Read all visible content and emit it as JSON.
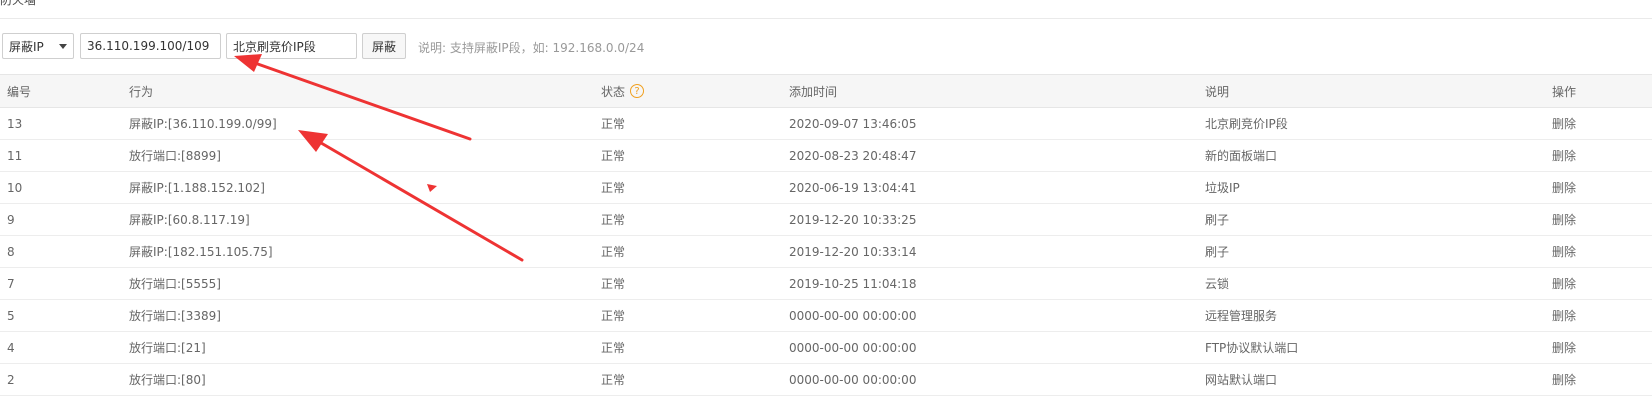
{
  "header": {
    "title_clipped": "防火墙"
  },
  "controls": {
    "type_select": "屏蔽IP",
    "ip_value": "36.110.199.100/109",
    "note_value": "北京刷竞价IP段",
    "submit_label": "屏蔽",
    "hint": "说明: 支持屏蔽IP段，如: 192.168.0.0/24"
  },
  "table": {
    "headers": {
      "id": "编号",
      "action": "行为",
      "status": "状态",
      "time": "添加时间",
      "note": "说明",
      "op": "操作"
    },
    "status_help": "?",
    "rows": [
      {
        "id": "13",
        "action": "屏蔽IP:[36.110.199.0/99]",
        "status": "正常",
        "time": "2020-09-07 13:46:05",
        "note": "北京刷竞价IP段",
        "op": "删除"
      },
      {
        "id": "11",
        "action": "放行端口:[8899]",
        "status": "正常",
        "time": "2020-08-23 20:48:47",
        "note": "新的面板端口",
        "op": "删除"
      },
      {
        "id": "10",
        "action": "屏蔽IP:[1.188.152.102]",
        "status": "正常",
        "time": "2020-06-19 13:04:41",
        "note": "垃圾IP",
        "op": "删除"
      },
      {
        "id": "9",
        "action": "屏蔽IP:[60.8.117.19]",
        "status": "正常",
        "time": "2019-12-20 10:33:25",
        "note": "刷子",
        "op": "删除"
      },
      {
        "id": "8",
        "action": "屏蔽IP:[182.151.105.75]",
        "status": "正常",
        "time": "2019-12-20 10:33:14",
        "note": "刷子",
        "op": "删除"
      },
      {
        "id": "7",
        "action": "放行端口:[5555]",
        "status": "正常",
        "time": "2019-10-25 11:04:18",
        "note": "云锁",
        "op": "删除"
      },
      {
        "id": "5",
        "action": "放行端口:[3389]",
        "status": "正常",
        "time": "0000-00-00 00:00:00",
        "note": "远程管理服务",
        "op": "删除"
      },
      {
        "id": "4",
        "action": "放行端口:[21]",
        "status": "正常",
        "time": "0000-00-00 00:00:00",
        "note": "FTP协议默认端口",
        "op": "删除"
      },
      {
        "id": "2",
        "action": "放行端口:[80]",
        "status": "正常",
        "time": "0000-00-00 00:00:00",
        "note": "网站默认端口",
        "op": "删除"
      }
    ]
  },
  "colors": {
    "accent_green": "#20a53a",
    "annotation_red": "#ee3333",
    "help_orange": "#f0a020"
  }
}
